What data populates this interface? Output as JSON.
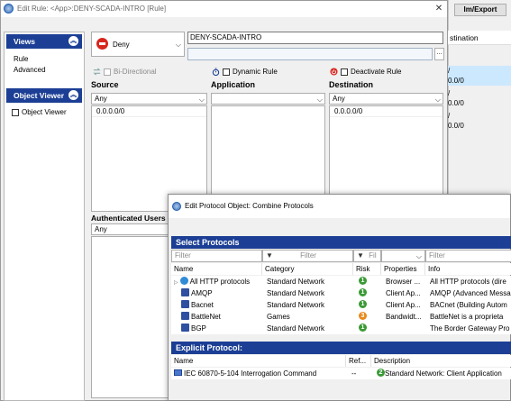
{
  "background": {
    "imexport_label": "Im/Export",
    "column_header": "stination",
    "rows": [
      "/",
      "0.0/0",
      "/",
      "0.0/0",
      "/",
      "0.0/0"
    ]
  },
  "edit_rule": {
    "title": "Edit Rule: <App>:DENY-SCADA-INTRO [Rule]",
    "close_label": "✕",
    "views": {
      "header": "Views",
      "items": [
        "Rule",
        "Advanced"
      ]
    },
    "object_viewer": {
      "header": "Object Viewer",
      "checkbox_label": "Object Viewer"
    },
    "action": {
      "value": "Deny"
    },
    "rule_name": "DENY-SCADA-INTRO",
    "description": "",
    "ellipsis_label": "...",
    "options": {
      "bidirectional": "Bi-Directional",
      "dynamic": "Dynamic Rule",
      "deactivate": "Deactivate Rule"
    },
    "source": {
      "header": "Source",
      "combo": "Any",
      "items": [
        "0.0.0.0/0"
      ]
    },
    "application": {
      "header": "Application",
      "combo": "",
      "items": []
    },
    "destination": {
      "header": "Destination",
      "combo": "Any",
      "items": [
        "0.0.0.0/0"
      ]
    },
    "authenticated_users": {
      "header": "Authenticated Users",
      "combo": "Any"
    }
  },
  "protocol_dialog": {
    "title": "Edit Protocol Object: Combine Protocols",
    "select_header": "Select Protocols",
    "filters": {
      "name": "Filter",
      "category": "Filter",
      "risk": "Fil",
      "info": "Filter"
    },
    "columns": {
      "name": "Name",
      "category": "Category",
      "risk": "Risk",
      "properties": "Properties",
      "info": "Info"
    },
    "rows": [
      {
        "name": "All HTTP protocols",
        "category": "Standard Network",
        "risk": "1",
        "risk_color": "#3a9a35",
        "properties": "Browser ...",
        "info": "All HTTP protocols (dire"
      },
      {
        "name": "AMQP",
        "category": "Standard Network",
        "risk": "1",
        "risk_color": "#3a9a35",
        "properties": "Client Ap...",
        "info": "AMQP (Advanced Messa"
      },
      {
        "name": "Bacnet",
        "category": "Standard Network",
        "risk": "1",
        "risk_color": "#3a9a35",
        "properties": "Client Ap...",
        "info": "BACnet (Building Autom"
      },
      {
        "name": "BattleNet",
        "category": "Games",
        "risk": "3",
        "risk_color": "#e8891b",
        "properties": "Bandwidt...",
        "info": "BattleNet is a proprieta"
      },
      {
        "name": "BGP",
        "category": "Standard Network",
        "risk": "1",
        "risk_color": "#3a9a35",
        "properties": "",
        "info": "The Border Gateway Pro"
      }
    ],
    "explicit_header": "Explicit Protocol:",
    "explicit_columns": {
      "name": "Name",
      "ref": "Ref...",
      "description": "Description"
    },
    "explicit_rows": [
      {
        "name": "IEC 60870-5-104 Interrogation Command",
        "ref": "--",
        "risk": "2",
        "description": "Standard Network: Client Application"
      }
    ]
  },
  "colors": {
    "header_blue": "#1c3f95",
    "deny_red": "#d7261e",
    "risk_green": "#3a9a35",
    "risk_orange": "#e8891b",
    "selection": "#cce8ff"
  }
}
